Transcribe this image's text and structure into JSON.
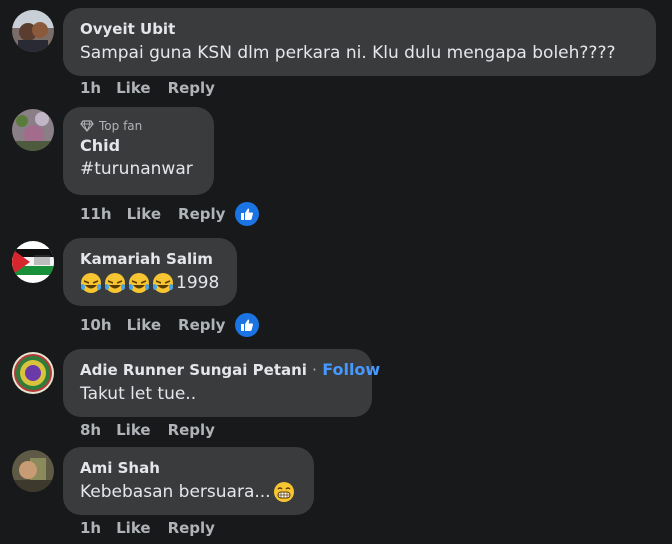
{
  "comments": [
    {
      "name": "Ovyeit Ubit",
      "text": "Sampai guna KSN dlm perkara ni. Klu dulu mengapa boleh????",
      "time": "1h",
      "like": "Like",
      "reply": "Reply"
    },
    {
      "badge": "Top fan",
      "name": "Chid",
      "text": "#turunanwar",
      "time": "11h",
      "like": "Like",
      "reply": "Reply"
    },
    {
      "name": "Kamariah Salim",
      "text": "1998",
      "time": "10h",
      "like": "Like",
      "reply": "Reply"
    },
    {
      "name": "Adie Runner Sungai Petani",
      "separator": "·",
      "follow": "Follow",
      "text": "Takut let tue..",
      "time": "8h",
      "like": "Like",
      "reply": "Reply"
    },
    {
      "name": "Ami Shah",
      "text": "Kebebasan bersuara...",
      "time": "1h",
      "like": "Like",
      "reply": "Reply"
    }
  ],
  "colors": {
    "background": "#18191a",
    "bubble": "#3a3b3c",
    "text": "#e4e6eb",
    "secondary": "#b0b3b8",
    "follow": "#4599ff",
    "like_reaction": "#1b74e4"
  },
  "icons": [
    "diamond-icon",
    "thumbs-up-icon",
    "laughing-emoji-icon",
    "grinning-emoji-icon"
  ]
}
